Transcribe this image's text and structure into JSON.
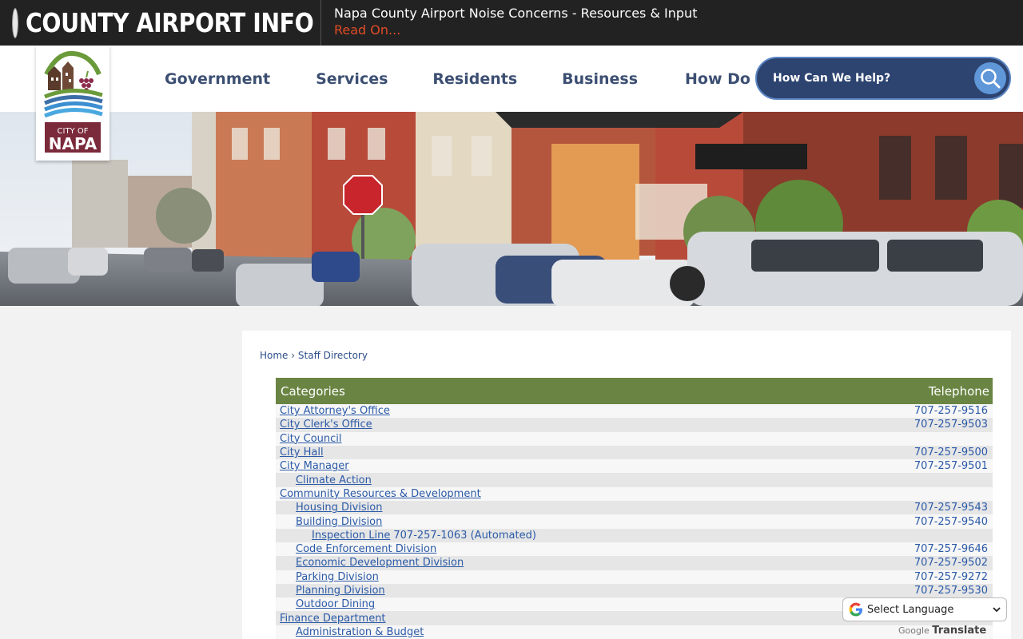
{
  "alert": {
    "title": "COUNTY AIRPORT INFO",
    "message": "Napa County Airport Noise Concerns - Resources & Input",
    "link": "Read On..."
  },
  "logo": {
    "line1": "CITY OF",
    "line2": "NAPA"
  },
  "nav": {
    "items": [
      "Government",
      "Services",
      "Residents",
      "Business",
      "How Do I..."
    ]
  },
  "search": {
    "placeholder": "How Can We Help?"
  },
  "breadcrumb": {
    "home": "Home",
    "separator": "›",
    "current": "Staff Directory"
  },
  "directory": {
    "headers": {
      "category": "Categories",
      "phone": "Telephone"
    },
    "rows": [
      {
        "level": 0,
        "name": "City Attorney's Office",
        "extra": "",
        "phone": "707-257-9516"
      },
      {
        "level": 0,
        "name": "City Clerk's Office",
        "extra": "",
        "phone": "707-257-9503"
      },
      {
        "level": 0,
        "name": "City Council",
        "extra": "",
        "phone": ""
      },
      {
        "level": 0,
        "name": "City Hall",
        "extra": "",
        "phone": "707-257-9500"
      },
      {
        "level": 0,
        "name": "City Manager",
        "extra": "",
        "phone": "707-257-9501"
      },
      {
        "level": 1,
        "name": "Climate Action",
        "extra": "",
        "phone": ""
      },
      {
        "level": 0,
        "name": "Community Resources & Development",
        "extra": "",
        "phone": ""
      },
      {
        "level": 1,
        "name": "Housing Division",
        "extra": "",
        "phone": "707-257-9543"
      },
      {
        "level": 1,
        "name": "Building Division",
        "extra": "",
        "phone": "707-257-9540"
      },
      {
        "level": 2,
        "name": "Inspection Line",
        "extra": "707-257-1063 (Automated)",
        "phone": ""
      },
      {
        "level": 1,
        "name": "Code Enforcement Division",
        "extra": "",
        "phone": "707-257-9646"
      },
      {
        "level": 1,
        "name": "Economic Development Division",
        "extra": "",
        "phone": "707-257-9502"
      },
      {
        "level": 1,
        "name": "Parking Division",
        "extra": "",
        "phone": "707-257-9272"
      },
      {
        "level": 1,
        "name": "Planning Division",
        "extra": "",
        "phone": "707-257-9530"
      },
      {
        "level": 1,
        "name": "Outdoor Dining",
        "extra": "",
        "phone": ""
      },
      {
        "level": 0,
        "name": "Finance Department",
        "extra": "",
        "phone": ""
      },
      {
        "level": 1,
        "name": "Administration & Budget",
        "extra": "",
        "phone": ""
      }
    ]
  },
  "translate": {
    "label": "Select Language",
    "powered_by": "Google",
    "translate_word": "Translate"
  },
  "colors": {
    "alert_bg": "#222222",
    "alert_link": "#e14c26",
    "nav_text": "#3c4f72",
    "search_bg": "#2d4470",
    "table_header": "#6a8543",
    "link": "#2b5aa7"
  }
}
